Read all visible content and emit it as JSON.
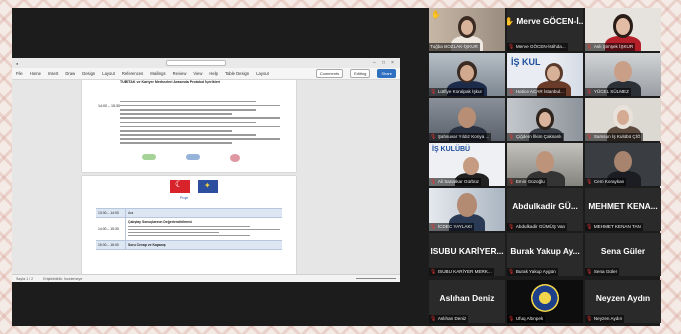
{
  "word": {
    "title_hint": "",
    "ribbon_tabs": [
      "File",
      "Home",
      "Insert",
      "Draw",
      "Design",
      "Layout",
      "References",
      "Mailings",
      "Review",
      "View",
      "Help",
      "Table Design",
      "Layout"
    ],
    "comments_label": "Comments",
    "editing_label": "Editing",
    "share_label": "Share",
    "status_left": "Sayfa 1 / 2",
    "status_mid": "Erişilebilirlik: İncelemeye",
    "page1": {
      "heading": "TÜBİTAK ve Kariyer Merkezleri Arasında Protokol İçerikleri",
      "time": "14:00 – 15:30"
    },
    "page2": {
      "eu_text": "Proje",
      "rows": [
        {
          "time": "13:30 – 14:00",
          "desc": "Ara"
        },
        {
          "time": "14:00 – 15:30",
          "desc": "Çalıştay Sonuçlarının Değerlendirilmesi"
        },
        {
          "time": "15:30 – 16:00",
          "desc": "Soru Cevap ve Kapanış"
        }
      ]
    }
  },
  "participants": [
    {
      "id": "p1",
      "label": "Tuğba BOZLAK-İŞKUR",
      "kind": "photo",
      "hand": true,
      "active": true,
      "mic": false
    },
    {
      "id": "p2",
      "name": "Merve GÖCEN-İ...",
      "label": "Merve GÖCEN-İstihda...",
      "kind": "name",
      "hand": true,
      "mic": true
    },
    {
      "id": "p3",
      "label": "Aslı Şimşek İŞKUR",
      "kind": "photo",
      "mic": true
    },
    {
      "id": "p4",
      "label": "Lütfiye Koralpak İşkur",
      "kind": "photo",
      "mic": true
    },
    {
      "id": "p5",
      "label": "Hatice ACAR İstanbul...",
      "kind": "photo",
      "mic": true
    },
    {
      "id": "p6",
      "label": "YÜCEL SÜLMEZ",
      "kind": "photo",
      "mic": true
    },
    {
      "id": "p7",
      "label": "Şahsuvar Yıldız Konya ...",
      "kind": "photo",
      "mic": true
    },
    {
      "id": "p8",
      "label": "Çiğdem İlkim Çaksanlı",
      "kind": "photo",
      "mic": true
    },
    {
      "id": "p9",
      "label": "Samsun İş Kulübü ÇİĞ",
      "kind": "photo",
      "mic": true
    },
    {
      "id": "p10",
      "label": "Ali Sanatkar Gürbüz",
      "kind": "photo",
      "mic": true
    },
    {
      "id": "p11",
      "label": "Emin Güzoğlu",
      "kind": "photo",
      "mic": true
    },
    {
      "id": "p12",
      "label": "Cem Koraykan",
      "kind": "photo",
      "mic": true
    },
    {
      "id": "p13",
      "label": "İCDEC YAYLAKI",
      "kind": "photo",
      "mic": true
    },
    {
      "id": "p14",
      "name": "Abdulkadir GÜ...",
      "label": "Abdulkadir GÜMÜŞ Van",
      "kind": "name",
      "mic": true
    },
    {
      "id": "p15",
      "name": "MEHMET KENA...",
      "label": "MEHMET KENAN TAN",
      "kind": "name",
      "mic": true
    },
    {
      "id": "p16",
      "name": "ISUBU KARİYER...",
      "label": "ISUBU KARİYER MERK...",
      "kind": "name",
      "mic": true
    },
    {
      "id": "p17",
      "name": "Burak Yakup Ay...",
      "label": "Burak Yakup Aygün",
      "kind": "name",
      "mic": true
    },
    {
      "id": "p18",
      "name": "Sena Güler",
      "label": "Sena Güler",
      "kind": "name",
      "mic": true
    },
    {
      "id": "p19",
      "name": "Aslıhan Deniz",
      "label": "Aslıhan Deniz",
      "kind": "name",
      "mic": true
    },
    {
      "id": "p20",
      "label": "Ufuq Altınpek",
      "kind": "emblem",
      "mic": true
    },
    {
      "id": "p21",
      "name": "Neyzen Aydın",
      "label": "Neyzen Aydın",
      "kind": "name",
      "mic": true
    }
  ],
  "icons": {
    "mic_muted": "mic-muted-icon",
    "raised_hand": "raised-hand-icon"
  },
  "colors": {
    "background": "#1c1c1c",
    "active_outline": "#f5d21a",
    "mic_muted": "#e33333",
    "hand": "#f5c518"
  }
}
